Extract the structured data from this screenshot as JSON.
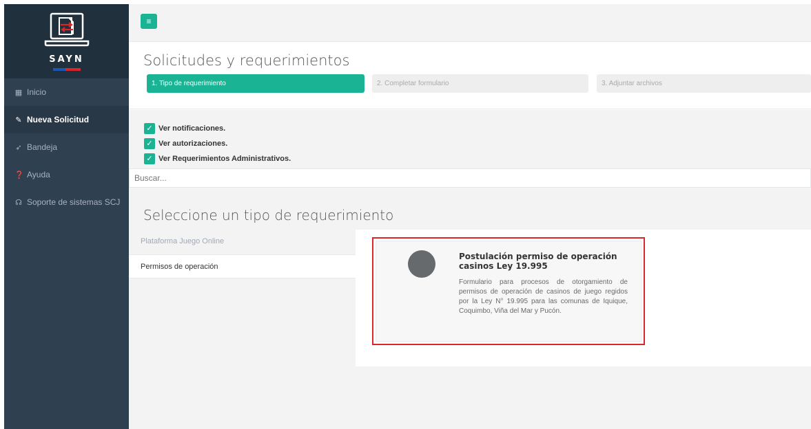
{
  "app": {
    "logo_text": "SAYN"
  },
  "sidebar": {
    "items": [
      {
        "label": "Inicio",
        "icon": "grid-icon"
      },
      {
        "label": "Nueva Solicitud",
        "icon": "edit-icon"
      },
      {
        "label": "Bandeja",
        "icon": "send-icon"
      },
      {
        "label": "Ayuda",
        "icon": "question-icon"
      },
      {
        "label": "Soporte de sistemas SCJ",
        "icon": "headset-icon"
      }
    ]
  },
  "topbar": {
    "menu_icon": "hamburger-icon"
  },
  "header": {
    "title": "Solicitudes y requerimientos",
    "steps": [
      {
        "label": "1. Tipo de requerimiento"
      },
      {
        "label": "2. Completar formulario"
      },
      {
        "label": "3. Adjuntar archivos"
      }
    ]
  },
  "filters": [
    {
      "label": "Ver notificaciones.",
      "checked": true
    },
    {
      "label": "Ver autorizaciones.",
      "checked": true
    },
    {
      "label": "Ver Requerimientos Administrativos.",
      "checked": true
    }
  ],
  "search": {
    "placeholder": "Buscar...",
    "value": ""
  },
  "section": {
    "title": "Seleccione un tipo de requerimiento",
    "tabs": [
      {
        "label": "Plataforma Juego Online"
      },
      {
        "label": "Permisos de operación"
      }
    ]
  },
  "card": {
    "title": "Postulación permiso de operación casinos Ley 19.995",
    "description": "Formulario para procesos de otorgamiento de permisos de operación de casinos de juego regidos por la Ley N° 19.995 para las comunas de Iquique, Coquimbo, Viña del Mar y Pucón."
  },
  "colors": {
    "accent": "#1ab394",
    "sidebar_bg": "#2f4050",
    "highlight_border": "#d9262a"
  }
}
